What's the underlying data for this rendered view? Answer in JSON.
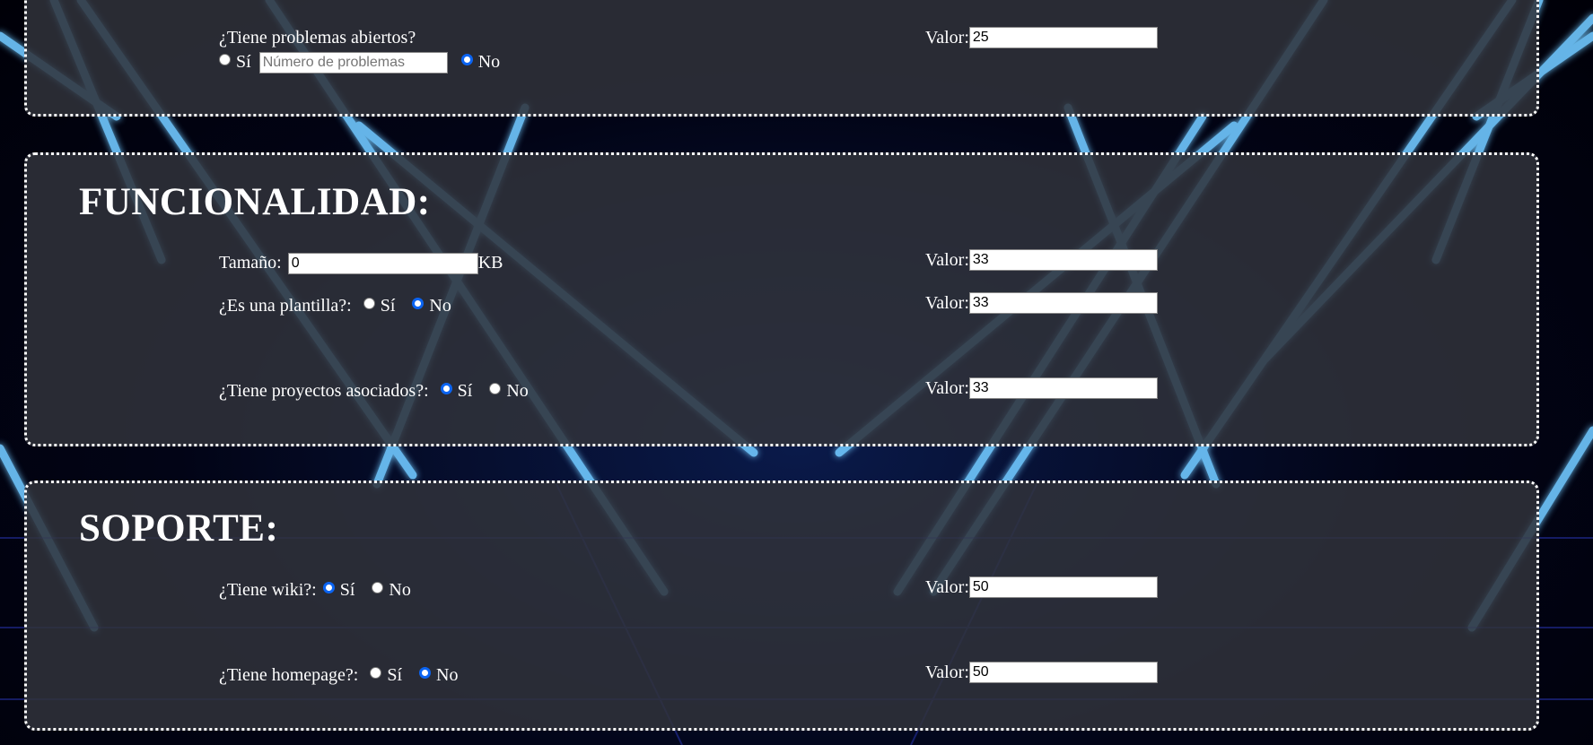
{
  "colors": {
    "panel_bg": "#30323a",
    "border": "#ffffff",
    "radio_accent": "#0b64f2",
    "neon_blue": "#3a8cff"
  },
  "calidad": {
    "problemas_label": "¿Tiene problemas abiertos?",
    "si_label": "Sí",
    "no_label": "No",
    "num_problemas_placeholder": "Número de problemas",
    "valor_label": "Valor:",
    "valor": "25",
    "selected": "No"
  },
  "funcionalidad": {
    "title": "FUNCIONALIDAD:",
    "tamano_label": "Tamaño:",
    "tamano_value": "0",
    "tamano_unit": "KB",
    "tamano_valor": "33",
    "plantilla_label": "¿Es una plantilla?:",
    "plantilla_selected": "No",
    "plantilla_valor": "33",
    "proyectos_label": "¿Tiene proyectos asociados?:",
    "proyectos_selected": "Sí",
    "proyectos_valor": "33",
    "si_label": "Sí",
    "no_label": "No",
    "valor_label": "Valor:"
  },
  "soporte": {
    "title": "SOPORTE:",
    "wiki_label": "¿Tiene wiki?:",
    "wiki_selected": "Sí",
    "wiki_valor": "50",
    "homepage_label": "¿Tiene homepage?:",
    "homepage_selected": "No",
    "homepage_valor": "50",
    "si_label": "Sí",
    "no_label": "No",
    "valor_label": "Valor:"
  }
}
